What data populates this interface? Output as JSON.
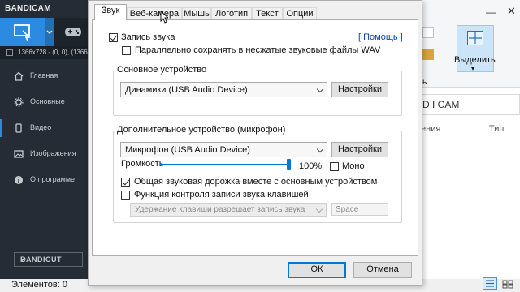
{
  "bandicam": {
    "logo": "BANDICAM",
    "info_text": "1366x728 - (0, 0), (1366x7",
    "nav": [
      {
        "label": "Главная",
        "icon": "home-icon"
      },
      {
        "label": "Основные",
        "icon": "gear-icon"
      },
      {
        "label": "Видео",
        "icon": "video-icon",
        "selected": true
      },
      {
        "label": "Изображения",
        "icon": "image-icon"
      },
      {
        "label": "О программе",
        "icon": "info-icon"
      }
    ],
    "bandicut_label": "BANDICUT",
    "bandicut_link": "↗"
  },
  "dialog": {
    "tabs": [
      "Звук",
      "Веб-камера",
      "Мышь",
      "Логотип",
      "Текст",
      "Опции"
    ],
    "active_tab": "Звук",
    "record_sound_label": "Запись звука",
    "record_sound_checked": true,
    "help_link": "[ Помощь ]",
    "save_wav_label": "Параллельно сохранять в несжатые звуковые файлы WAV",
    "save_wav_checked": false,
    "main_device": {
      "group_label": "Основное устройство",
      "selected": "Динамики (USB Audio Device)",
      "settings_button": "Настройки"
    },
    "secondary_device": {
      "group_label": "Дополнительное устройство (микрофон)",
      "selected": "Микрофон (USB Audio Device)",
      "settings_button": "Настройки",
      "volume_label": "Громкость",
      "volume_value": "100%",
      "volume_level": 1.0,
      "mono_label": "Моно",
      "mono_checked": false,
      "common_track_label": "Общая звуковая дорожка вместе с основным устройством",
      "common_track_checked": true,
      "hotkey_label": "Функция контроля записи звука клавишей",
      "hotkey_checked": false,
      "hotkey_mode": "Удержание клавиши разрешает запись звука",
      "hotkey_key": "Space"
    },
    "ok_button": "ОК",
    "cancel_button": "Отмена"
  },
  "explorer": {
    "select_label": "Выделить",
    "left_partial": "ь",
    "address_text": "D I CAM",
    "col_name": "ения",
    "col_type": "Тип",
    "status": "Элементов: 0",
    "minimize": "—",
    "close": "✕"
  }
}
